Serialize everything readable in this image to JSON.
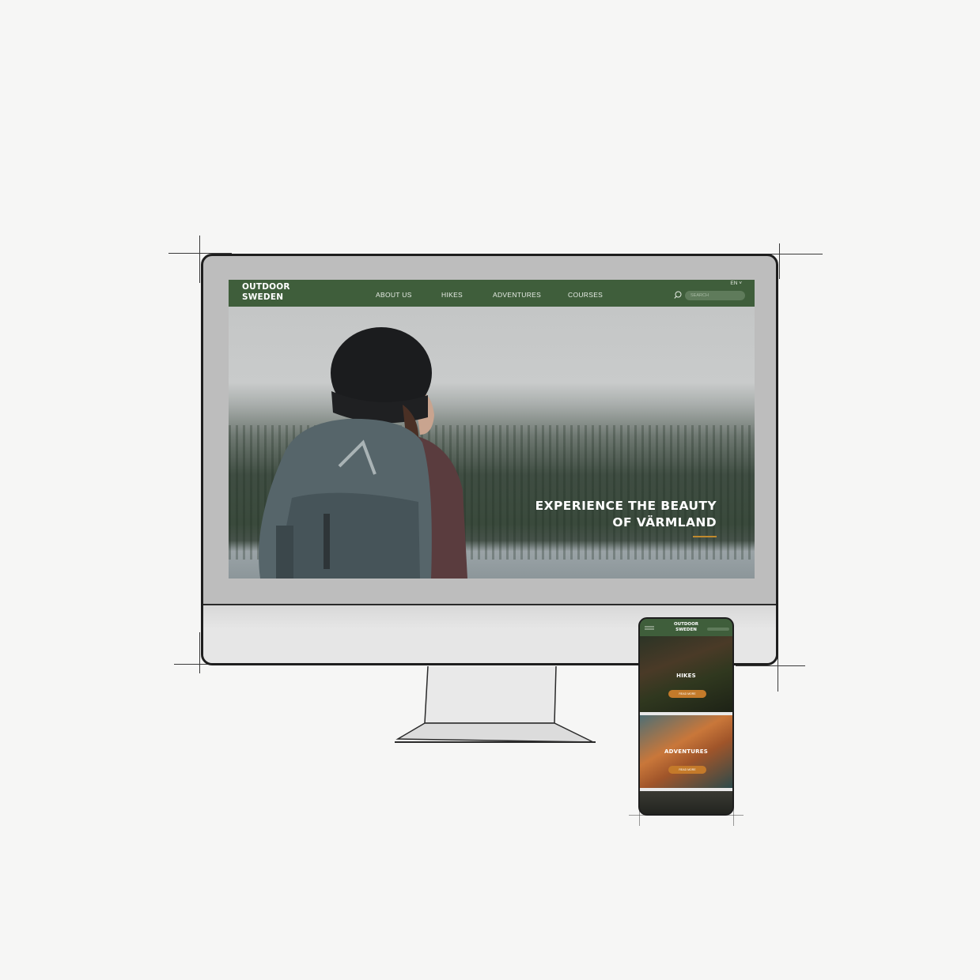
{
  "desktop": {
    "logo_line1": "OUTDOOR",
    "logo_line2": "SWEDEN",
    "nav": [
      "ABOUT US",
      "HIKES",
      "ADVENTURES",
      "COURSES"
    ],
    "language": "EN",
    "search_placeholder": "SEARCH",
    "hero_title_line1": "EXPERIENCE THE BEAUTY",
    "hero_title_line2": "OF VÄRMLAND"
  },
  "mobile": {
    "logo_line1": "OUTDOOR",
    "logo_line2": "SWEDEN",
    "sections": [
      {
        "title": "HIKES",
        "button": "READ MORE"
      },
      {
        "title": "ADVENTURES",
        "button": "READ MORE"
      }
    ]
  },
  "colors": {
    "nav_green": "#3f5e3b",
    "accent_orange": "#c47a2a",
    "background": "#f6f6f5"
  }
}
